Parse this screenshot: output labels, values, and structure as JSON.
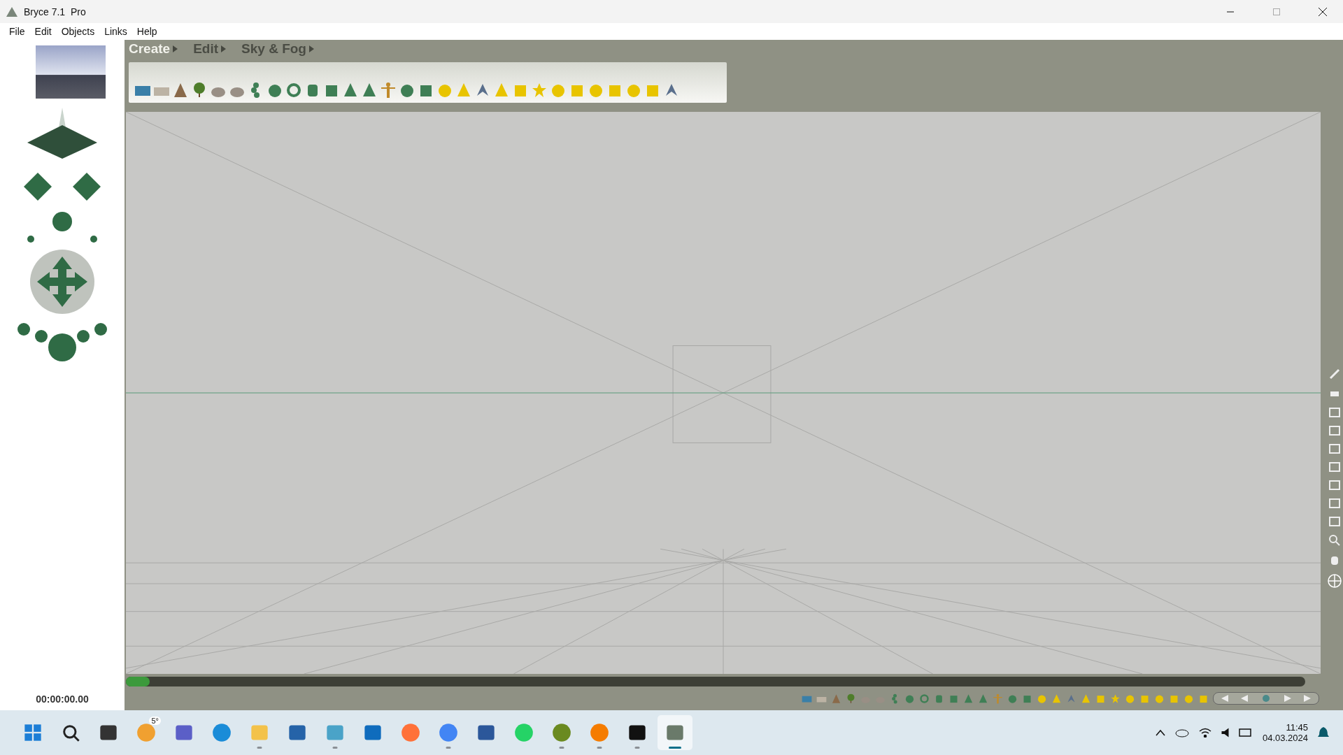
{
  "window": {
    "title": "Bryce 7.1  Pro"
  },
  "menu": [
    {
      "label": "File"
    },
    {
      "label": "Edit"
    },
    {
      "label": "Objects"
    },
    {
      "label": "Links"
    },
    {
      "label": "Help"
    }
  ],
  "palette_tabs": [
    {
      "label": "Create",
      "selected": true
    },
    {
      "label": "Edit",
      "selected": false
    },
    {
      "label": "Sky & Fog",
      "selected": false
    }
  ],
  "timeline": {
    "time": "00:00:00.00",
    "level": 0.02
  },
  "taskbar": {
    "apps": [
      {
        "kind": "start",
        "running": false,
        "selected": false
      },
      {
        "kind": "search",
        "running": false,
        "selected": false
      },
      {
        "kind": "taskview",
        "running": false,
        "selected": false
      },
      {
        "kind": "weather",
        "badge": "5°",
        "running": false,
        "selected": false
      },
      {
        "kind": "teams",
        "running": false,
        "selected": false
      },
      {
        "kind": "edge",
        "running": false,
        "selected": false
      },
      {
        "kind": "explorer",
        "running": true,
        "selected": false
      },
      {
        "kind": "store",
        "running": false,
        "selected": false
      },
      {
        "kind": "notepad",
        "running": true,
        "selected": false
      },
      {
        "kind": "outlook",
        "running": false,
        "selected": false
      },
      {
        "kind": "firefox",
        "running": false,
        "selected": false
      },
      {
        "kind": "chrome",
        "running": true,
        "selected": false
      },
      {
        "kind": "word",
        "running": false,
        "selected": false
      },
      {
        "kind": "whatsapp",
        "running": false,
        "selected": false
      },
      {
        "kind": "globe",
        "running": true,
        "selected": false
      },
      {
        "kind": "player",
        "running": true,
        "selected": false
      },
      {
        "kind": "daz",
        "running": true,
        "selected": false
      },
      {
        "kind": "bryce",
        "running": true,
        "selected": true
      }
    ],
    "clock": {
      "time": "11:45",
      "date": "04.03.2024"
    }
  }
}
